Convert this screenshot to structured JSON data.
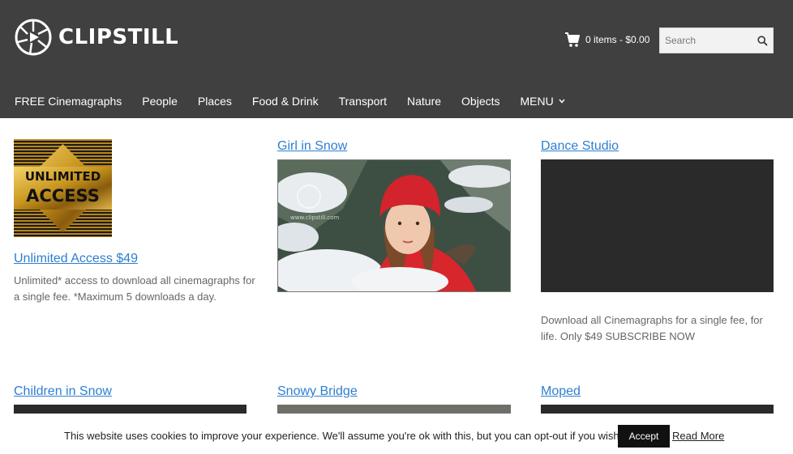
{
  "brand": {
    "name": "CLIPSTILL"
  },
  "cart": {
    "label": "0 items - $0.00"
  },
  "search": {
    "placeholder": "Search"
  },
  "nav": {
    "items": [
      "FREE Cinemagraphs",
      "People",
      "Places",
      "Food & Drink",
      "Transport",
      "Nature",
      "Objects",
      "MENU"
    ]
  },
  "products": [
    {
      "title": "Unlimited Access $49",
      "description": "Unlimited* access to download all cinemagraphs for a single fee. *Maximum 5 downloads a day.",
      "badge_line1": "UNLIMITED",
      "badge_line2": "ACCESS"
    },
    {
      "title": "Girl in Snow",
      "watermark": "www.clipstill.com"
    },
    {
      "title": "Dance Studio",
      "description": "Download all Cinemagraphs for a single fee, for life. Only $49 SUBSCRIBE NOW"
    },
    {
      "title": "Children in Snow"
    },
    {
      "title": "Snowy Bridge"
    },
    {
      "title": "Moped"
    }
  ],
  "cookie": {
    "message": "This website uses cookies to improve your experience. We'll assume you're ok with this, but you can opt-out if you wish.",
    "accept_label": "Accept",
    "read_more_label": "Read More"
  },
  "colors": {
    "header_bg": "#404040",
    "link": "#2e7fcf",
    "gold": "#c9961f"
  },
  "icons": [
    "logo-icon",
    "cart-icon",
    "search-icon",
    "chevron-down-icon"
  ]
}
